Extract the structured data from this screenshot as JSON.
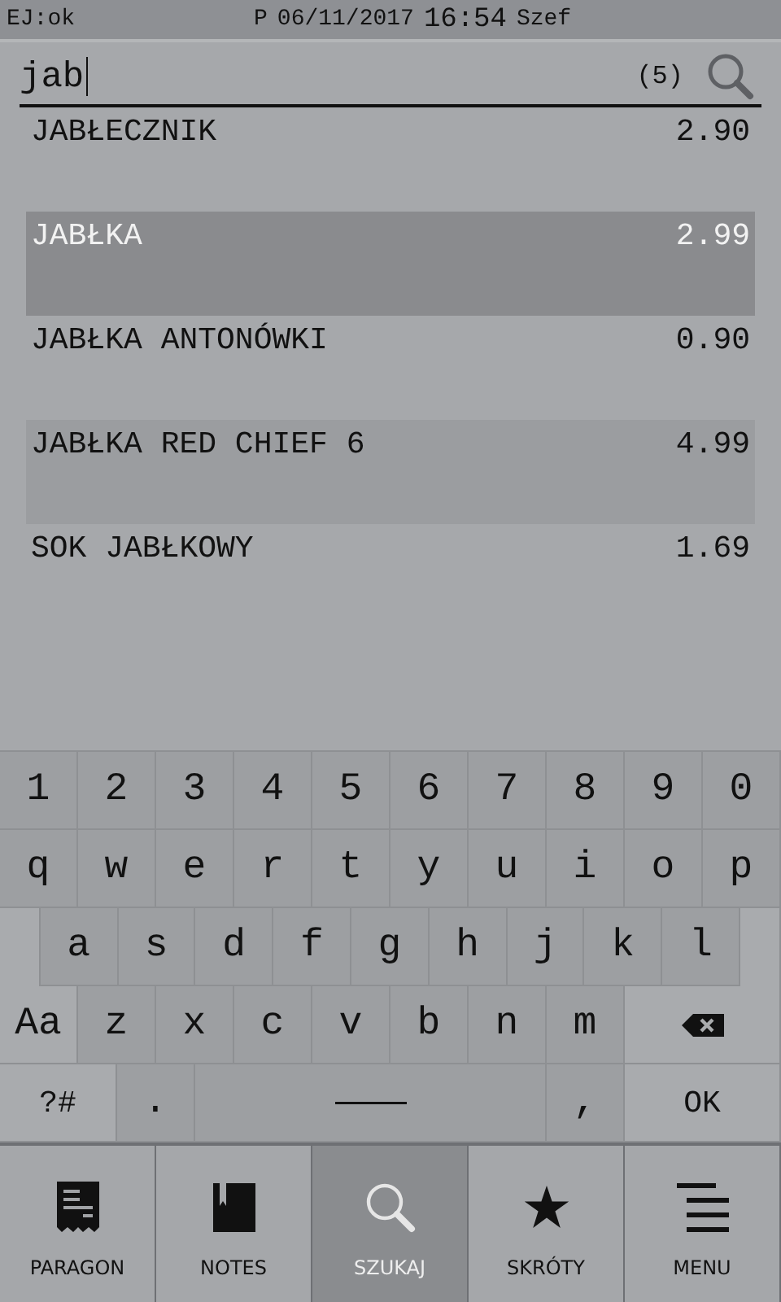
{
  "status_bar": {
    "left": "EJ:ok",
    "printer": "P",
    "date": "06/11/2017",
    "time": "16:54",
    "user": "Szef"
  },
  "search": {
    "value": "jab",
    "count": "(5)"
  },
  "results": [
    {
      "name": "JABŁECZNIK",
      "price": "2.90",
      "selected": false
    },
    {
      "name": "JABŁKA",
      "price": "2.99",
      "selected": true
    },
    {
      "name": "JABŁKA ANTONÓWKI",
      "price": "0.90",
      "selected": false
    },
    {
      "name": "JABŁKA RED CHIEF 6",
      "price": "4.99",
      "selected": false
    },
    {
      "name": "SOK JABŁKOWY",
      "price": "1.69",
      "selected": false
    }
  ],
  "keyboard": [
    [
      {
        "kind": "key",
        "label": "1"
      },
      {
        "kind": "key",
        "label": "2"
      },
      {
        "kind": "key",
        "label": "3"
      },
      {
        "kind": "key",
        "label": "4"
      },
      {
        "kind": "key",
        "label": "5"
      },
      {
        "kind": "key",
        "label": "6"
      },
      {
        "kind": "key",
        "label": "7"
      },
      {
        "kind": "key",
        "label": "8"
      },
      {
        "kind": "key",
        "label": "9"
      },
      {
        "kind": "key",
        "label": "0"
      }
    ],
    [
      {
        "kind": "key",
        "label": "q"
      },
      {
        "kind": "key",
        "label": "w"
      },
      {
        "kind": "key",
        "label": "e"
      },
      {
        "kind": "key",
        "label": "r"
      },
      {
        "kind": "key",
        "label": "t"
      },
      {
        "kind": "key",
        "label": "y"
      },
      {
        "kind": "key",
        "label": "u"
      },
      {
        "kind": "key",
        "label": "i"
      },
      {
        "kind": "key",
        "label": "o"
      },
      {
        "kind": "key",
        "label": "p"
      }
    ],
    [
      {
        "kind": "key",
        "label": "a"
      },
      {
        "kind": "key",
        "label": "s"
      },
      {
        "kind": "key",
        "label": "d"
      },
      {
        "kind": "key",
        "label": "f"
      },
      {
        "kind": "key",
        "label": "g"
      },
      {
        "kind": "key",
        "label": "h"
      },
      {
        "kind": "key",
        "label": "j"
      },
      {
        "kind": "key",
        "label": "k"
      },
      {
        "kind": "key",
        "label": "l"
      }
    ],
    [
      {
        "kind": "shift",
        "label": "Aa"
      },
      {
        "kind": "key",
        "label": "z"
      },
      {
        "kind": "key",
        "label": "x"
      },
      {
        "kind": "key",
        "label": "c"
      },
      {
        "kind": "key",
        "label": "v"
      },
      {
        "kind": "key",
        "label": "b"
      },
      {
        "kind": "key",
        "label": "n"
      },
      {
        "kind": "key",
        "label": "m"
      },
      {
        "kind": "backspace"
      }
    ],
    [
      {
        "kind": "symbols",
        "label": "?#"
      },
      {
        "kind": "key",
        "label": "."
      },
      {
        "kind": "space"
      },
      {
        "kind": "key",
        "label": ","
      },
      {
        "kind": "ok",
        "label": "OK"
      }
    ]
  ],
  "nav": [
    {
      "kind": "receipt",
      "label": "PARAGON",
      "selected": false
    },
    {
      "kind": "notes",
      "label": "NOTES",
      "selected": false
    },
    {
      "kind": "search",
      "label": "SZUKAJ",
      "selected": true
    },
    {
      "kind": "star",
      "label": "SKRÓTY",
      "selected": false
    },
    {
      "kind": "menu",
      "label": "MENU",
      "selected": false
    }
  ]
}
